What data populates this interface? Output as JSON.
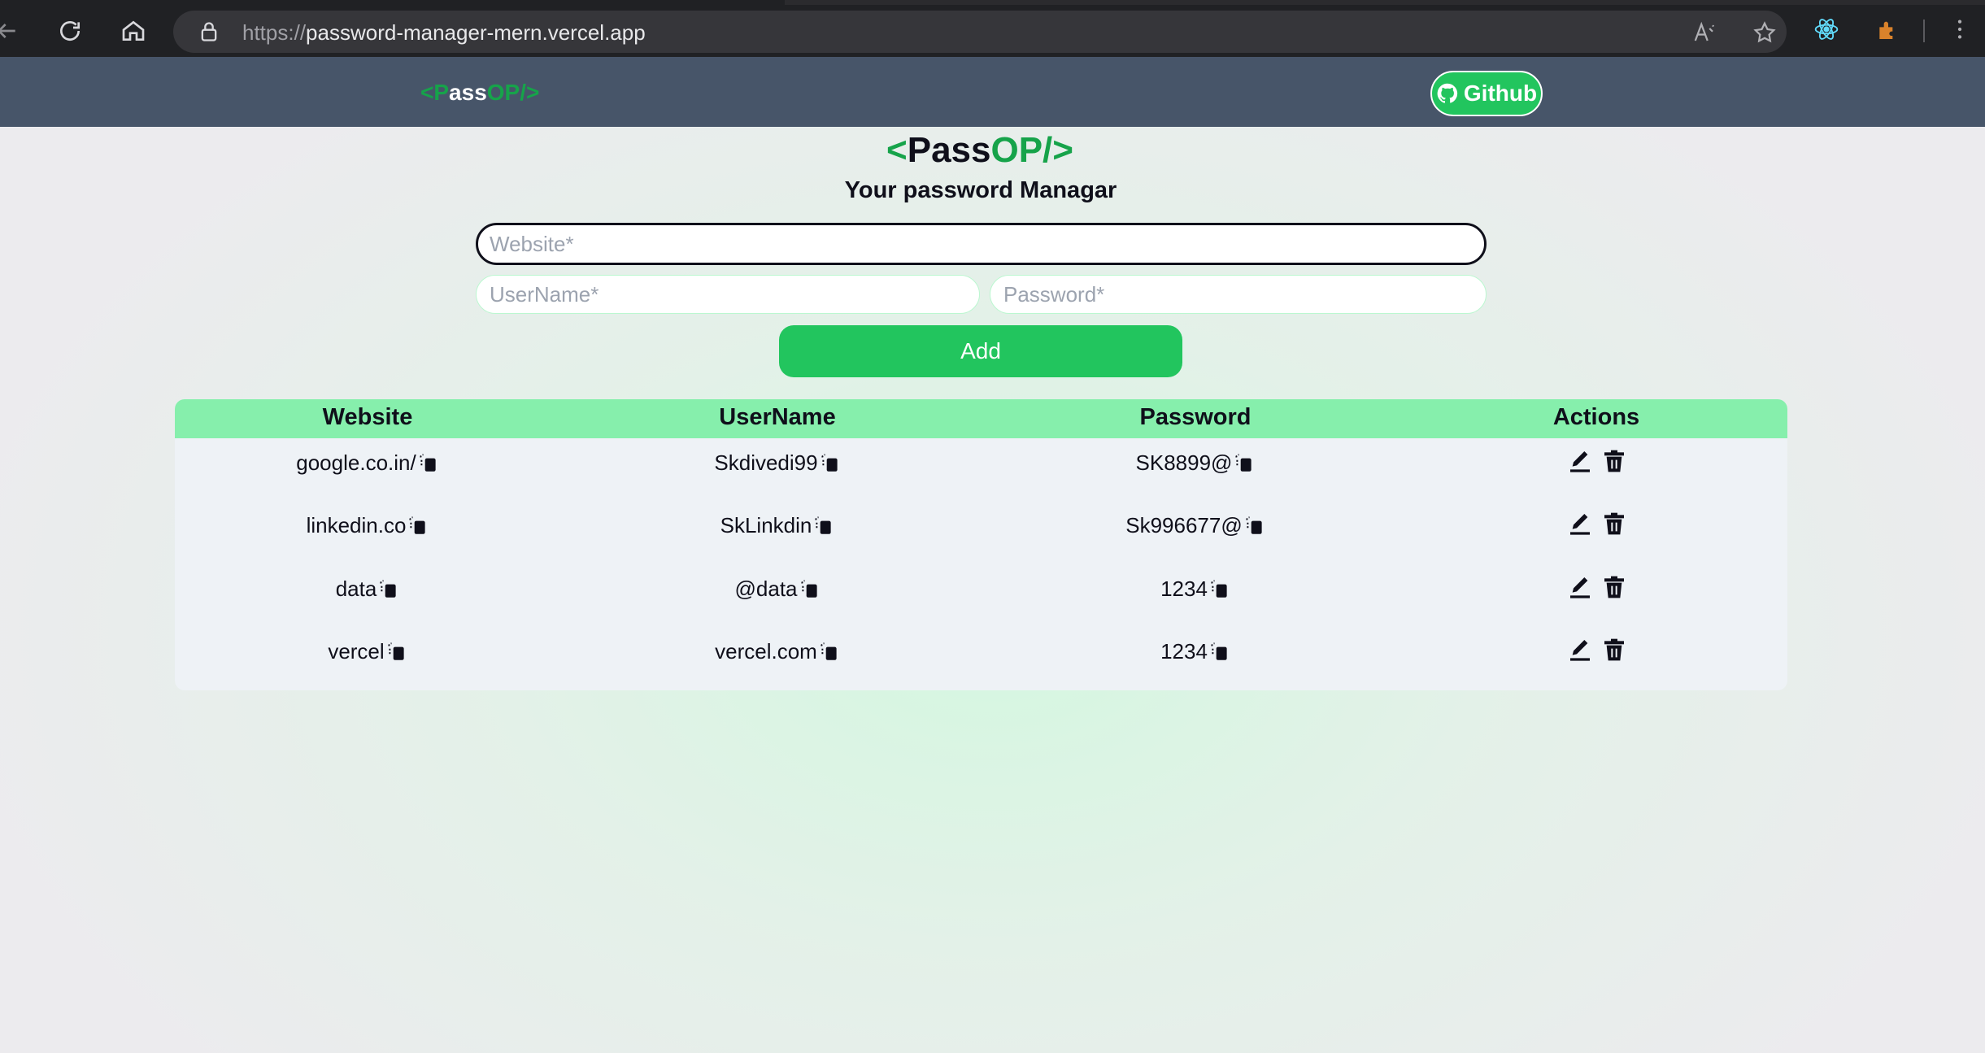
{
  "browser": {
    "url_protocol": "https://",
    "url_host": "password-manager-mern.vercel.app"
  },
  "navbar": {
    "logo": {
      "lt": "<",
      "p": "P",
      "ass": "ass",
      "op": "OP/>"
    },
    "github_label": "Github"
  },
  "main": {
    "brand": {
      "lt": "<",
      "pass": "Pass",
      "op": "OP/>"
    },
    "subtitle": "Your password Managar",
    "website_placeholder": "Website*",
    "username_placeholder": "UserName*",
    "password_placeholder": "Password*",
    "add_label": "Add"
  },
  "table": {
    "headers": [
      "Website",
      "UserName",
      "Password",
      "Actions"
    ],
    "rows": [
      {
        "website": "google.co.in/",
        "username": "Skdivedi99",
        "password": "SK8899@"
      },
      {
        "website": "linkedin.co",
        "username": "SkLinkdin",
        "password": "Sk996677@"
      },
      {
        "website": "data",
        "username": "@data",
        "password": "1234"
      },
      {
        "website": "vercel",
        "username": "vercel.com",
        "password": "1234"
      }
    ]
  },
  "colors": {
    "accent_green": "#22c55e",
    "logo_green": "#16a34a",
    "header_green": "#86efac",
    "navbar": "#475569"
  },
  "icons": [
    "back-icon",
    "reload-icon",
    "home-icon",
    "lock-icon",
    "read-aloud-icon",
    "favorite-star-icon",
    "react-devtools-icon",
    "extension-icon",
    "github-icon",
    "copy-icon",
    "edit-icon",
    "delete-icon"
  ]
}
